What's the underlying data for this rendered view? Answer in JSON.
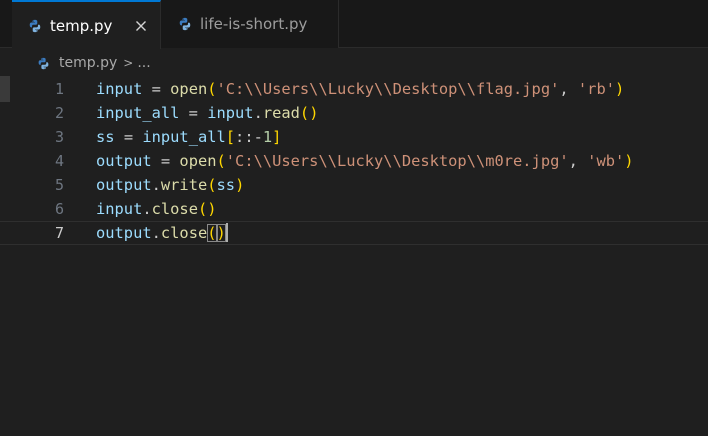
{
  "tabs": [
    {
      "label": "temp.py",
      "active": true,
      "icon": "python-file-icon"
    },
    {
      "label": "life-is-short.py",
      "active": false,
      "icon": "python-file-icon"
    }
  ],
  "breadcrumb": {
    "file": "temp.py",
    "separator": ">",
    "more": "..."
  },
  "editor": {
    "current_line": 7,
    "lines": [
      {
        "num": "1",
        "tokens": [
          [
            "v",
            "input"
          ],
          [
            "o",
            " = "
          ],
          [
            "f",
            "open"
          ],
          [
            "p",
            "("
          ],
          [
            "s",
            "'C:\\\\Users\\\\Lucky\\\\Desktop\\\\flag.jpg'"
          ],
          [
            "o",
            ", "
          ],
          [
            "s",
            "'rb'"
          ],
          [
            "p",
            ")"
          ]
        ]
      },
      {
        "num": "2",
        "tokens": [
          [
            "v",
            "input_all"
          ],
          [
            "o",
            " = "
          ],
          [
            "v",
            "input"
          ],
          [
            "o",
            "."
          ],
          [
            "f",
            "read"
          ],
          [
            "p",
            "()"
          ]
        ]
      },
      {
        "num": "3",
        "tokens": [
          [
            "v",
            "ss"
          ],
          [
            "o",
            " = "
          ],
          [
            "v",
            "input_all"
          ],
          [
            "p",
            "["
          ],
          [
            "o",
            "::"
          ],
          [
            "o",
            "-"
          ],
          [
            "n",
            "1"
          ],
          [
            "p",
            "]"
          ]
        ]
      },
      {
        "num": "4",
        "tokens": [
          [
            "v",
            "output"
          ],
          [
            "o",
            " = "
          ],
          [
            "f",
            "open"
          ],
          [
            "p",
            "("
          ],
          [
            "s",
            "'C:\\\\Users\\\\Lucky\\\\Desktop\\\\m0re.jpg'"
          ],
          [
            "o",
            ", "
          ],
          [
            "s",
            "'wb'"
          ],
          [
            "p",
            ")"
          ]
        ]
      },
      {
        "num": "5",
        "tokens": [
          [
            "v",
            "output"
          ],
          [
            "o",
            "."
          ],
          [
            "f",
            "write"
          ],
          [
            "p",
            "("
          ],
          [
            "v",
            "ss"
          ],
          [
            "p",
            ")"
          ]
        ]
      },
      {
        "num": "6",
        "tokens": [
          [
            "v",
            "input"
          ],
          [
            "o",
            "."
          ],
          [
            "f",
            "close"
          ],
          [
            "p",
            "()"
          ]
        ]
      },
      {
        "num": "7",
        "tokens": [
          [
            "v",
            "output"
          ],
          [
            "o",
            "."
          ],
          [
            "f",
            "close"
          ],
          [
            "pm",
            "("
          ],
          [
            "pm",
            ")"
          ]
        ]
      }
    ]
  },
  "colors": {
    "active_tab_border": "#0078d4",
    "variable": "#9cdcfe",
    "function": "#dcdcaa",
    "string": "#ce9178",
    "number": "#b5cea8",
    "bracket": "#ffd700"
  }
}
